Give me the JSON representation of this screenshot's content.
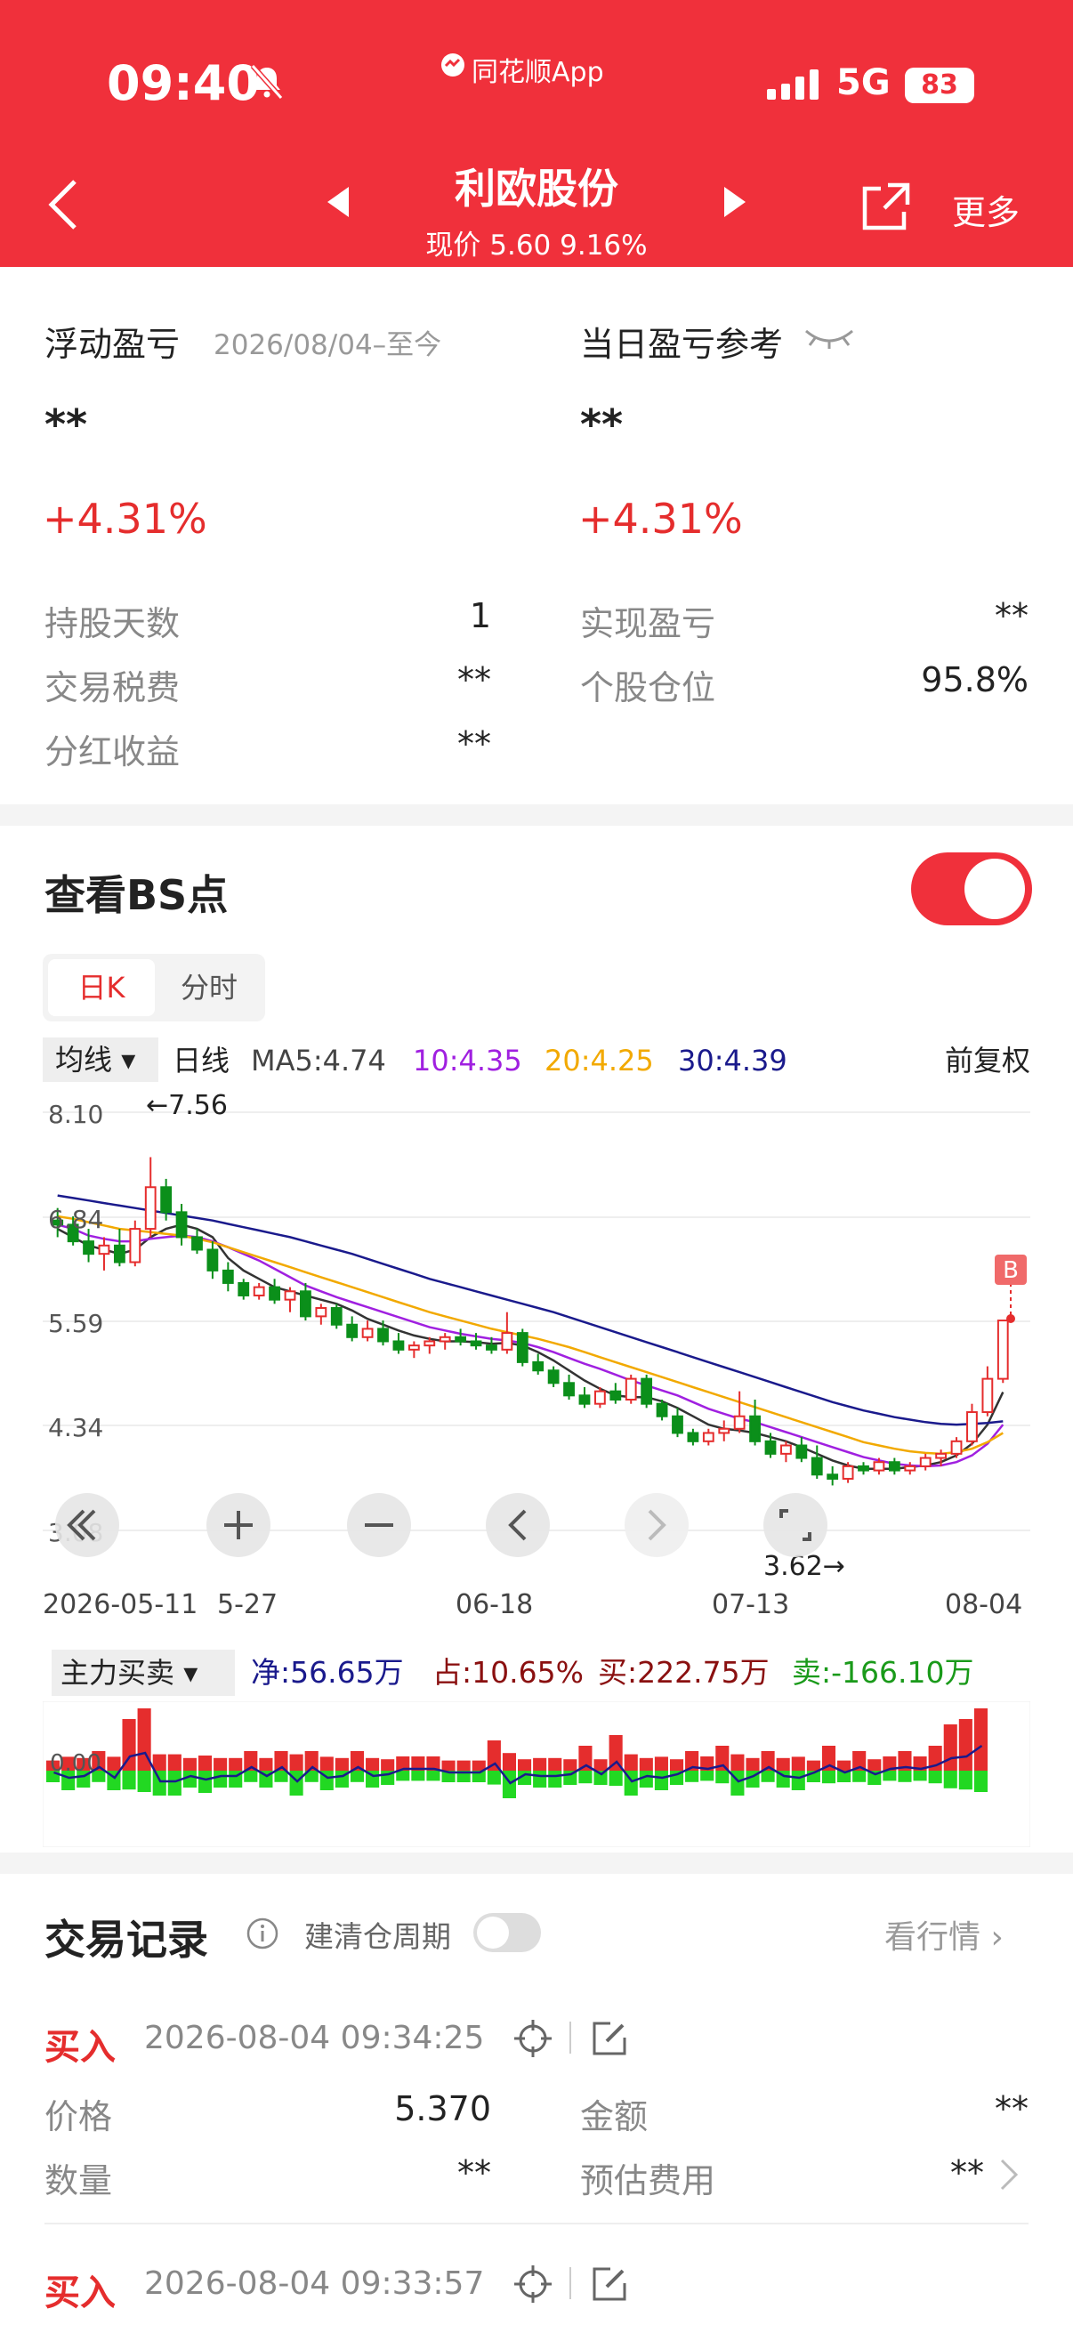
{
  "status": {
    "time": "09:40",
    "app": "同花顺App",
    "network": "5G",
    "battery": "83"
  },
  "header": {
    "title": "利欧股份",
    "subtitle": "现价 5.60 9.16%",
    "more": "更多"
  },
  "summary": {
    "floating_pl": {
      "label": "浮动盈亏",
      "period": "2026/08/04–至今",
      "amount": "**",
      "pct": "+4.31%"
    },
    "daily_pl": {
      "label": "当日盈亏参考",
      "amount": "**",
      "pct": "+4.31%"
    },
    "rows_left": [
      {
        "label": "持股天数",
        "value": "1"
      },
      {
        "label": "交易税费",
        "value": "**"
      },
      {
        "label": "分红收益",
        "value": "**"
      }
    ],
    "rows_right": [
      {
        "label": "实现盈亏",
        "value": "**"
      },
      {
        "label": "个股仓位",
        "value": "95.8%"
      }
    ]
  },
  "bs": {
    "title": "查看BS点",
    "tabs": [
      "日K",
      "分时"
    ],
    "ma_select": "均线",
    "ma_line": "日线",
    "ma5": "MA5:4.74",
    "ma10": "10:4.35",
    "ma20": "20:4.25",
    "ma30": "30:4.39",
    "adjust": "前复权",
    "high_label": "←7.56",
    "low_label": "3.62→",
    "b_marker": "B",
    "colors": {
      "up": "#e52d2d",
      "down": "#0b8f1a",
      "ma5": "#333333",
      "ma10": "#a020e0",
      "ma20": "#f2a900",
      "ma30": "#1a1a8c"
    },
    "flow": {
      "select": "主力买卖",
      "net": "净:56.65万",
      "share": "占:10.65%",
      "buy": "买:222.75万",
      "sell": "卖:-166.10万",
      "zero_label": "0.00"
    }
  },
  "chart_data": {
    "type": "candlestick",
    "y_ticks": [
      "8.10",
      "6.84",
      "5.59",
      "4.34",
      "3.08"
    ],
    "ylim": [
      3.08,
      8.1
    ],
    "x_ticks": [
      "2026-05-11",
      "5-27",
      "06-18",
      "07-13",
      "08-04"
    ],
    "candles": [
      [
        6.8,
        6.95,
        6.6,
        6.75
      ],
      [
        6.75,
        6.85,
        6.5,
        6.55
      ],
      [
        6.55,
        6.7,
        6.3,
        6.4
      ],
      [
        6.4,
        6.6,
        6.2,
        6.5
      ],
      [
        6.5,
        6.7,
        6.25,
        6.3
      ],
      [
        6.3,
        6.8,
        6.25,
        6.7
      ],
      [
        6.7,
        7.56,
        6.6,
        7.2
      ],
      [
        7.2,
        7.3,
        6.8,
        6.9
      ],
      [
        6.9,
        7.0,
        6.5,
        6.6
      ],
      [
        6.6,
        6.7,
        6.4,
        6.45
      ],
      [
        6.45,
        6.55,
        6.1,
        6.2
      ],
      [
        6.2,
        6.3,
        5.95,
        6.05
      ],
      [
        6.05,
        6.1,
        5.85,
        5.9
      ],
      [
        5.9,
        6.05,
        5.85,
        6.0
      ],
      [
        6.0,
        6.1,
        5.8,
        5.85
      ],
      [
        5.85,
        6.0,
        5.7,
        5.95
      ],
      [
        5.95,
        6.05,
        5.6,
        5.65
      ],
      [
        5.65,
        5.8,
        5.55,
        5.75
      ],
      [
        5.75,
        5.8,
        5.5,
        5.55
      ],
      [
        5.55,
        5.65,
        5.35,
        5.4
      ],
      [
        5.4,
        5.6,
        5.35,
        5.5
      ],
      [
        5.5,
        5.6,
        5.3,
        5.35
      ],
      [
        5.35,
        5.45,
        5.2,
        5.25
      ],
      [
        5.25,
        5.35,
        5.15,
        5.3
      ],
      [
        5.3,
        5.4,
        5.2,
        5.35
      ],
      [
        5.35,
        5.45,
        5.25,
        5.4
      ],
      [
        5.4,
        5.5,
        5.3,
        5.35
      ],
      [
        5.35,
        5.45,
        5.25,
        5.3
      ],
      [
        5.3,
        5.4,
        5.2,
        5.25
      ],
      [
        5.25,
        5.7,
        5.2,
        5.45
      ],
      [
        5.45,
        5.5,
        5.05,
        5.1
      ],
      [
        5.1,
        5.2,
        4.95,
        5.0
      ],
      [
        5.0,
        5.05,
        4.8,
        4.85
      ],
      [
        4.85,
        4.95,
        4.65,
        4.7
      ],
      [
        4.7,
        4.8,
        4.55,
        4.6
      ],
      [
        4.6,
        4.8,
        4.55,
        4.75
      ],
      [
        4.75,
        4.85,
        4.6,
        4.65
      ],
      [
        4.65,
        4.95,
        4.6,
        4.9
      ],
      [
        4.9,
        4.95,
        4.55,
        4.6
      ],
      [
        4.6,
        4.65,
        4.4,
        4.45
      ],
      [
        4.45,
        4.55,
        4.2,
        4.25
      ],
      [
        4.25,
        4.3,
        4.1,
        4.15
      ],
      [
        4.15,
        4.3,
        4.1,
        4.25
      ],
      [
        4.25,
        4.4,
        4.15,
        4.3
      ],
      [
        4.3,
        4.75,
        4.25,
        4.45
      ],
      [
        4.45,
        4.65,
        4.1,
        4.15
      ],
      [
        4.15,
        4.25,
        3.95,
        4.0
      ],
      [
        4.0,
        4.15,
        3.9,
        4.1
      ],
      [
        4.1,
        4.2,
        3.9,
        3.95
      ],
      [
        3.95,
        4.1,
        3.7,
        3.75
      ],
      [
        3.75,
        3.85,
        3.62,
        3.7
      ],
      [
        3.7,
        3.9,
        3.65,
        3.85
      ],
      [
        3.85,
        3.9,
        3.75,
        3.8
      ],
      [
        3.8,
        3.95,
        3.75,
        3.9
      ],
      [
        3.9,
        3.95,
        3.75,
        3.8
      ],
      [
        3.8,
        3.9,
        3.75,
        3.85
      ],
      [
        3.85,
        4.0,
        3.8,
        3.95
      ],
      [
        3.95,
        4.05,
        3.85,
        4.0
      ],
      [
        4.0,
        4.2,
        3.95,
        4.15
      ],
      [
        4.15,
        4.6,
        4.1,
        4.5
      ],
      [
        4.5,
        5.05,
        4.45,
        4.9
      ],
      [
        4.9,
        5.6,
        4.85,
        5.6
      ]
    ],
    "series": [
      {
        "name": "MA5",
        "values": [
          6.7,
          6.6,
          6.5,
          6.45,
          6.4,
          6.45,
          6.6,
          6.7,
          6.75,
          6.7,
          6.6,
          6.35,
          6.2,
          6.1,
          6.0,
          5.95,
          5.9,
          5.85,
          5.8,
          5.72,
          5.62,
          5.55,
          5.48,
          5.42,
          5.38,
          5.35,
          5.35,
          5.34,
          5.32,
          5.33,
          5.3,
          5.22,
          5.12,
          5.0,
          4.88,
          4.78,
          4.7,
          4.68,
          4.68,
          4.63,
          4.55,
          4.45,
          4.35,
          4.3,
          4.28,
          4.25,
          4.2,
          4.15,
          4.08,
          4.0,
          3.92,
          3.86,
          3.82,
          3.82,
          3.82,
          3.84,
          3.86,
          3.9,
          3.98,
          4.12,
          4.35,
          4.74
        ]
      },
      {
        "name": "10",
        "values": [
          6.75,
          6.7,
          6.62,
          6.58,
          6.55,
          6.55,
          6.58,
          6.6,
          6.62,
          6.6,
          6.55,
          6.48,
          6.4,
          6.32,
          6.22,
          6.12,
          6.02,
          5.95,
          5.88,
          5.82,
          5.76,
          5.7,
          5.64,
          5.58,
          5.52,
          5.48,
          5.44,
          5.41,
          5.38,
          5.36,
          5.33,
          5.28,
          5.22,
          5.15,
          5.08,
          5.02,
          4.95,
          4.88,
          4.82,
          4.76,
          4.7,
          4.62,
          4.54,
          4.48,
          4.42,
          4.38,
          4.32,
          4.26,
          4.2,
          4.14,
          4.08,
          4.02,
          3.96,
          3.92,
          3.88,
          3.86,
          3.85,
          3.86,
          3.9,
          3.98,
          4.12,
          4.35
        ]
      },
      {
        "name": "20",
        "values": [
          6.85,
          6.82,
          6.78,
          6.74,
          6.7,
          6.68,
          6.66,
          6.64,
          6.62,
          6.58,
          6.54,
          6.48,
          6.42,
          6.36,
          6.3,
          6.24,
          6.18,
          6.12,
          6.06,
          6.0,
          5.94,
          5.88,
          5.82,
          5.76,
          5.7,
          5.65,
          5.6,
          5.55,
          5.5,
          5.46,
          5.42,
          5.38,
          5.33,
          5.28,
          5.22,
          5.16,
          5.1,
          5.04,
          4.98,
          4.92,
          4.86,
          4.8,
          4.74,
          4.68,
          4.62,
          4.56,
          4.5,
          4.44,
          4.38,
          4.32,
          4.26,
          4.2,
          4.14,
          4.1,
          4.06,
          4.03,
          4.01,
          4.0,
          4.02,
          4.06,
          4.14,
          4.25
        ]
      },
      {
        "name": "30",
        "values": [
          7.1,
          7.07,
          7.04,
          7.01,
          6.98,
          6.95,
          6.92,
          6.89,
          6.86,
          6.83,
          6.8,
          6.76,
          6.72,
          6.68,
          6.64,
          6.6,
          6.55,
          6.5,
          6.45,
          6.4,
          6.34,
          6.28,
          6.22,
          6.16,
          6.1,
          6.05,
          6.0,
          5.95,
          5.9,
          5.85,
          5.8,
          5.75,
          5.7,
          5.64,
          5.58,
          5.52,
          5.46,
          5.4,
          5.34,
          5.28,
          5.22,
          5.16,
          5.1,
          5.04,
          4.98,
          4.92,
          4.86,
          4.8,
          4.74,
          4.68,
          4.62,
          4.57,
          4.52,
          4.48,
          4.44,
          4.41,
          4.38,
          4.36,
          4.35,
          4.36,
          4.37,
          4.39
        ]
      }
    ]
  },
  "records": {
    "title": "交易记录",
    "cycle_label": "建清仓周期",
    "market_link": "看行情",
    "items": [
      {
        "type": "买入",
        "time": "2026-08-04 09:34:25",
        "price_label": "价格",
        "price": "5.370",
        "amount_label": "金额",
        "amount": "**",
        "qty_label": "数量",
        "qty": "**",
        "fee_label": "预估费用",
        "fee": "**"
      },
      {
        "type": "买入",
        "time": "2026-08-04 09:33:57"
      }
    ]
  }
}
